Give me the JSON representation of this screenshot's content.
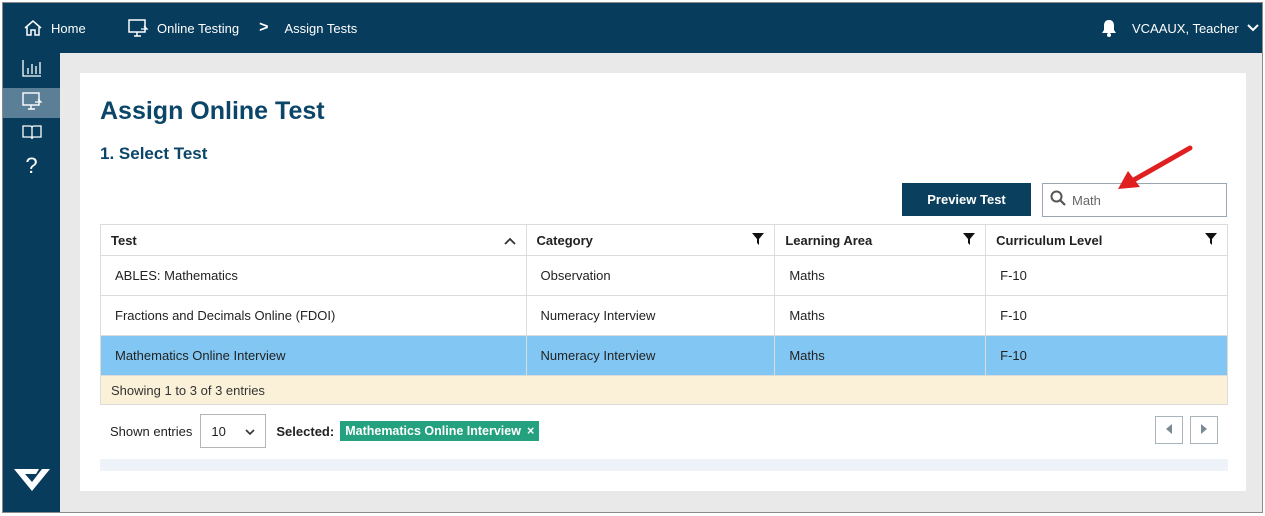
{
  "topbar": {
    "home_label": "Home",
    "crumb_online_testing": "Online Testing",
    "crumb_separator": ">",
    "crumb_assign_tests": "Assign Tests",
    "user_label": "VCAAUX, Teacher"
  },
  "sidebar": {
    "items": [
      {
        "icon": "bar-chart-icon"
      },
      {
        "icon": "monitor-icon",
        "active": true
      },
      {
        "icon": "book-icon"
      },
      {
        "icon": "help-icon",
        "glyph": "?"
      }
    ]
  },
  "page": {
    "title": "Assign Online Test",
    "step_title": "1. Select Test",
    "preview_button": "Preview Test",
    "search_value": "Math"
  },
  "table": {
    "columns": [
      "Test",
      "Category",
      "Learning Area",
      "Curriculum Level"
    ],
    "rows": [
      {
        "test": "ABLES: Mathematics",
        "category": "Observation",
        "area": "Maths",
        "level": "F-10"
      },
      {
        "test": "Fractions and Decimals Online (FDOI)",
        "category": "Numeracy Interview",
        "area": "Maths",
        "level": "F-10"
      },
      {
        "test": "Mathematics Online Interview",
        "category": "Numeracy Interview",
        "area": "Maths",
        "level": "F-10",
        "selected": true
      }
    ],
    "info_text": "Showing 1 to 3 of 3 entries"
  },
  "footer": {
    "shown_entries_label": "Shown entries",
    "entries_value": "10",
    "selected_label": "Selected:",
    "selected_chip": "Mathematics Online Interview",
    "chip_close": "×"
  },
  "colors": {
    "navy": "#073c5c",
    "selected_row": "#82c7f3",
    "chip_green": "#24a17f",
    "info_bg": "#fbf1d9",
    "annotation_arrow": "#e02020"
  }
}
